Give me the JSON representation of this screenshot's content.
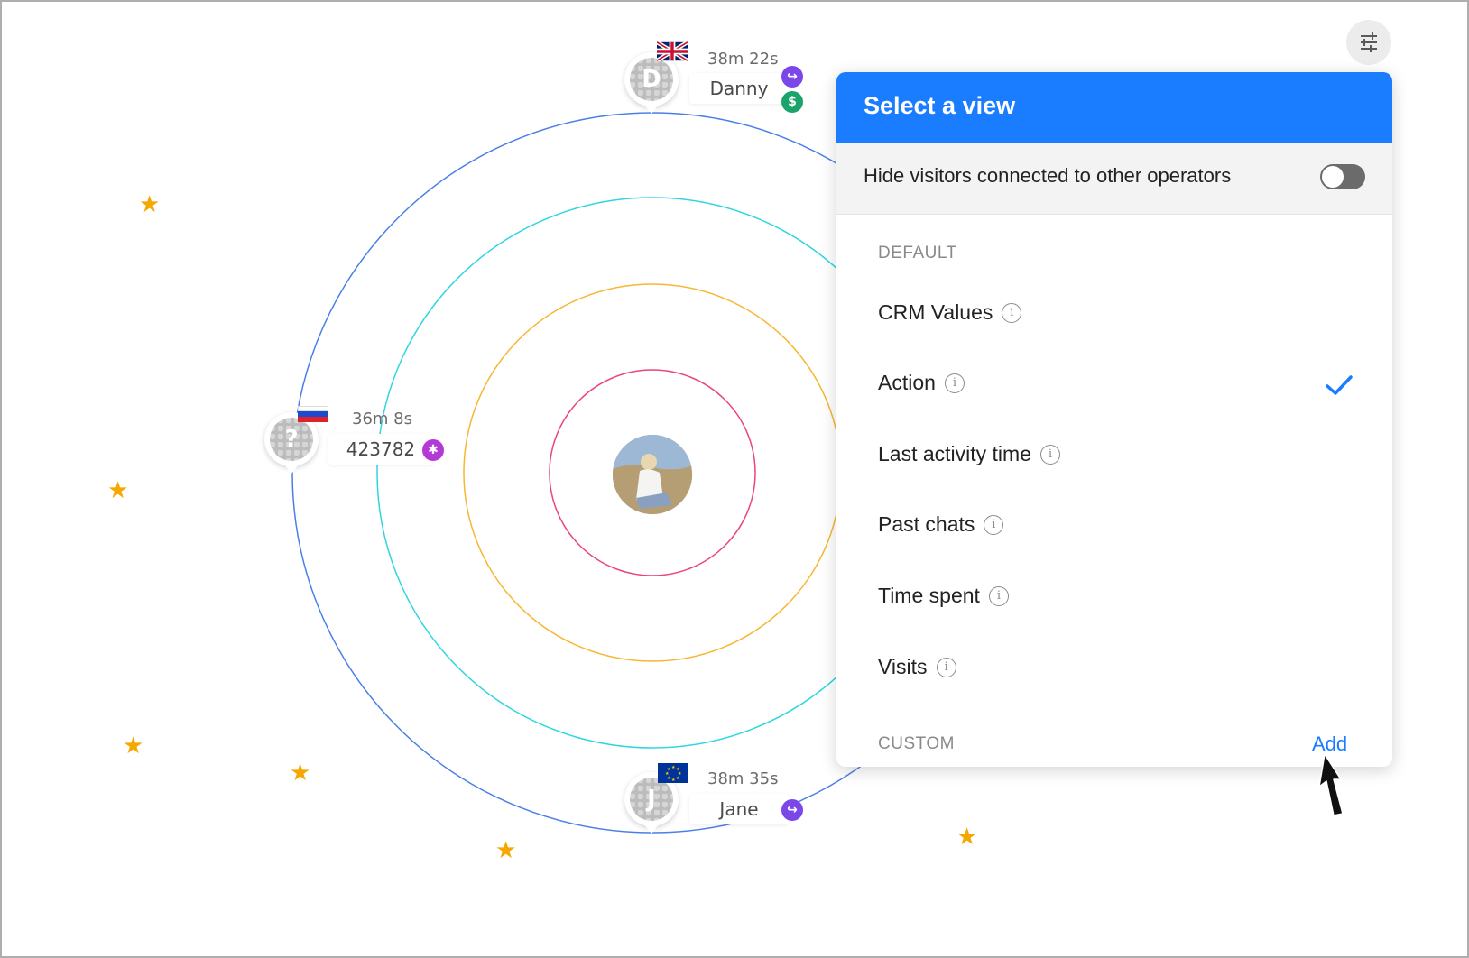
{
  "radar": {
    "ring_colors": [
      "#e8467c",
      "#f7b733",
      "#2fd6e0",
      "#4a7fe8"
    ],
    "background_decoration": "star-icon",
    "star_color": "#f4a800"
  },
  "operator": {
    "avatar_icon": "operator-photo"
  },
  "visitors": [
    {
      "name": "Danny",
      "time": "38m 22s",
      "initial": "D",
      "flag": "uk-flag",
      "badges": [
        "redirect-icon",
        "dollar-icon"
      ]
    },
    {
      "name": "423782",
      "time": "36m 8s",
      "initial": "?",
      "flag": "russia-flag",
      "badges": [
        "asterisk-icon"
      ]
    },
    {
      "name": "Jane",
      "time": "38m 35s",
      "initial": "J",
      "flag": "eu-flag",
      "badges": [
        "redirect-icon"
      ]
    }
  ],
  "settings": {
    "icon": "sliders-icon"
  },
  "panel": {
    "title": "Select a view",
    "hide_label": "Hide visitors connected to other operators",
    "hide_toggle_on": false,
    "default_section": "DEFAULT",
    "options": [
      {
        "label": "CRM Values",
        "selected": false
      },
      {
        "label": "Action",
        "selected": true
      },
      {
        "label": "Last activity time",
        "selected": false
      },
      {
        "label": "Past chats",
        "selected": false
      },
      {
        "label": "Time spent",
        "selected": false
      },
      {
        "label": "Visits",
        "selected": false
      }
    ],
    "custom_section": "CUSTOM",
    "add_label": "Add",
    "accent_color": "#1a7cff"
  }
}
